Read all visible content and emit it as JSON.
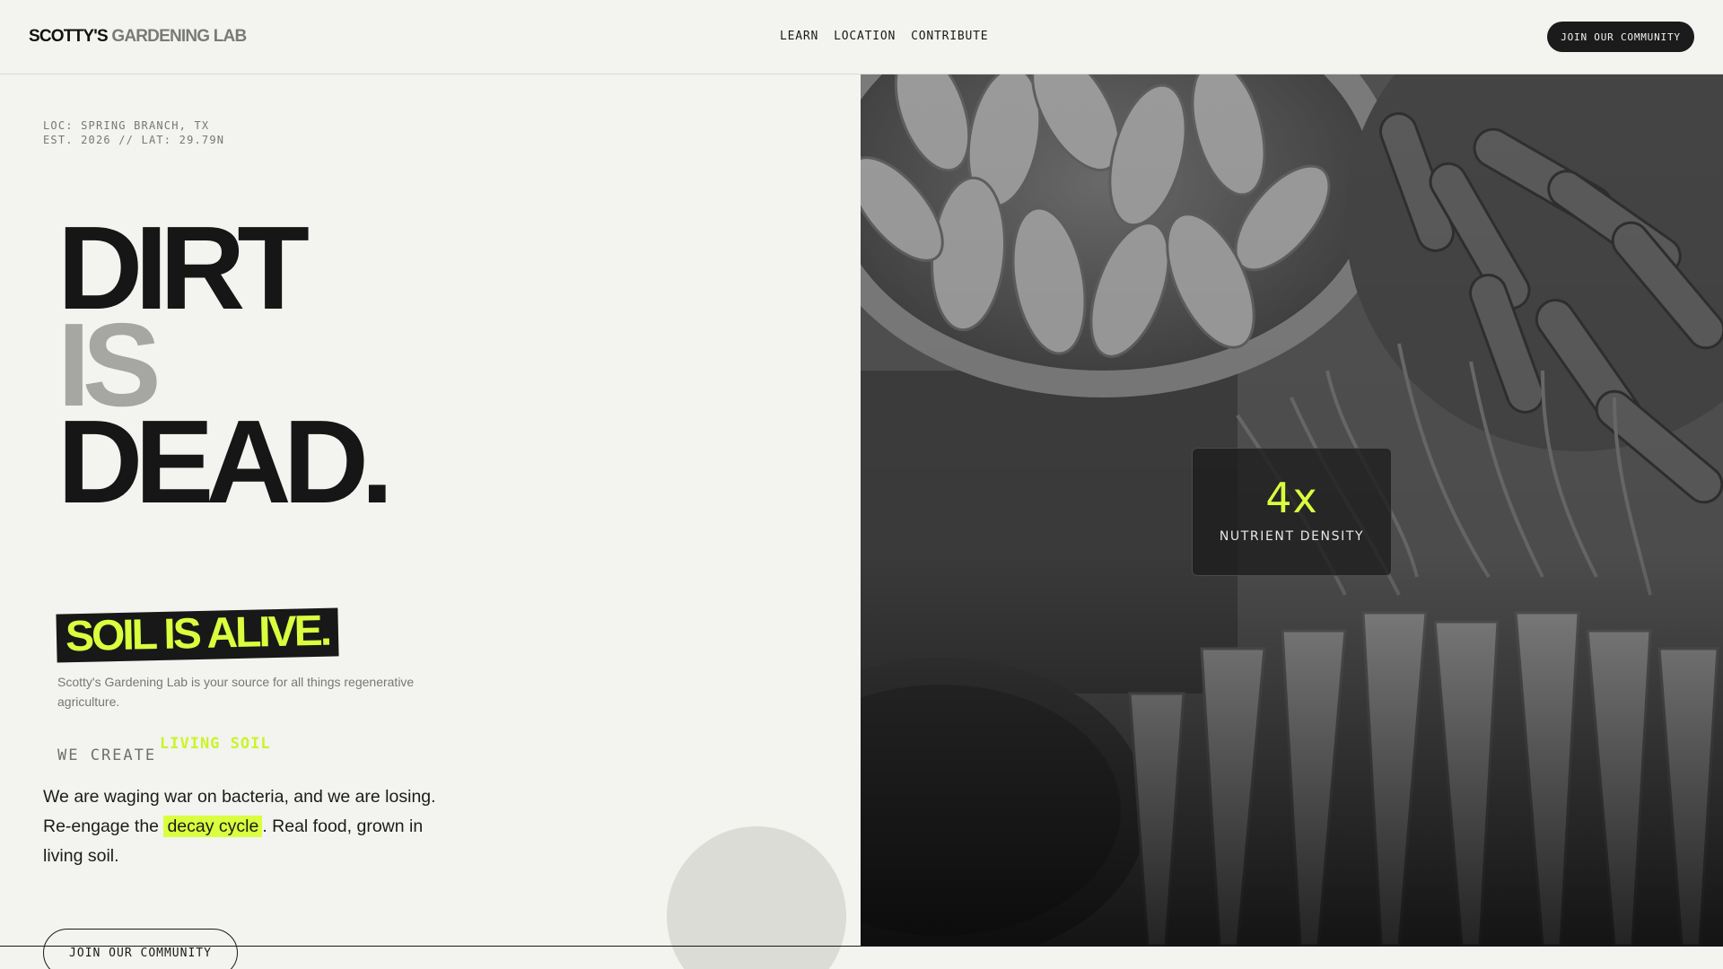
{
  "brand": {
    "part1": "SCOTTY'S",
    "part2": " GARDENING LAB"
  },
  "nav": [
    "LEARN",
    "LOCATION",
    "CONTRIBUTE"
  ],
  "header_cta": "JOIN OUR COMMUNITY",
  "meta": {
    "line1": "LOC: SPRING BRANCH, TX",
    "line2": "EST. 2026 // LAT: 29.79N"
  },
  "headline": {
    "line1": "DIRT",
    "line2": "IS",
    "line3": "DEAD."
  },
  "tagline": "SOIL IS ALIVE.",
  "intro": "Scotty's Gardening Lab is your source for all things regenerative agriculture.",
  "create": {
    "label": "WE CREATE",
    "accent": "LIVING SOIL"
  },
  "body": {
    "line1": "We are waging war on bacteria, and we are losing.",
    "prefix": "Re-engage the ",
    "highlight": "decay cycle",
    "suffix": ". Real food, grown in living soil."
  },
  "cta": "JOIN OUR COMMUNITY",
  "stat": {
    "value": "4x",
    "label": "NUTRIENT DENSITY"
  },
  "colors": {
    "accent": "#d9ff3e",
    "ink": "#1a1a1a",
    "background": "#f3f3ef"
  }
}
